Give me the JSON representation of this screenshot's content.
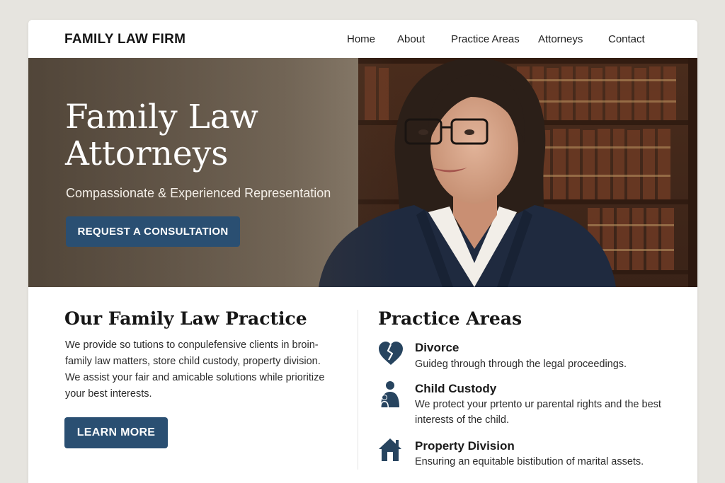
{
  "nav": {
    "brand": "FAMILY LAW FIRM",
    "links": [
      "Home",
      "About",
      "Practice Areas",
      "Attorneys",
      "Contact"
    ]
  },
  "hero": {
    "title": "Family Law Attorneys",
    "subtitle": "Compassionate & Experienced Representation",
    "cta_label": "REQUEST A CONSULTATION"
  },
  "practice": {
    "heading": "Our Family Law Practice",
    "body": "We provide so tutions to conpulefensive clients in broin-family law matters, store child custody, property division. We assist your fair and amicable solutions while prioritize your best interests.",
    "button_label": "LEARN MORE"
  },
  "areas": {
    "heading": "Practice Areas",
    "items": [
      {
        "title": "Divorce",
        "description": "Guideg through through the legal proceedings.",
        "icon": "broken-heart-icon"
      },
      {
        "title": "Child Custody",
        "description": "We protect your prtento ur parental rights and the best interests of the child.",
        "icon": "parent-child-icon"
      },
      {
        "title": "Property Division",
        "description": "Ensuring an equitable bistibution of marital assets.",
        "icon": "house-icon"
      }
    ]
  },
  "colors": {
    "accent": "#2a4f72",
    "icon": "#27445f",
    "page_bg": "#e6e4df"
  }
}
